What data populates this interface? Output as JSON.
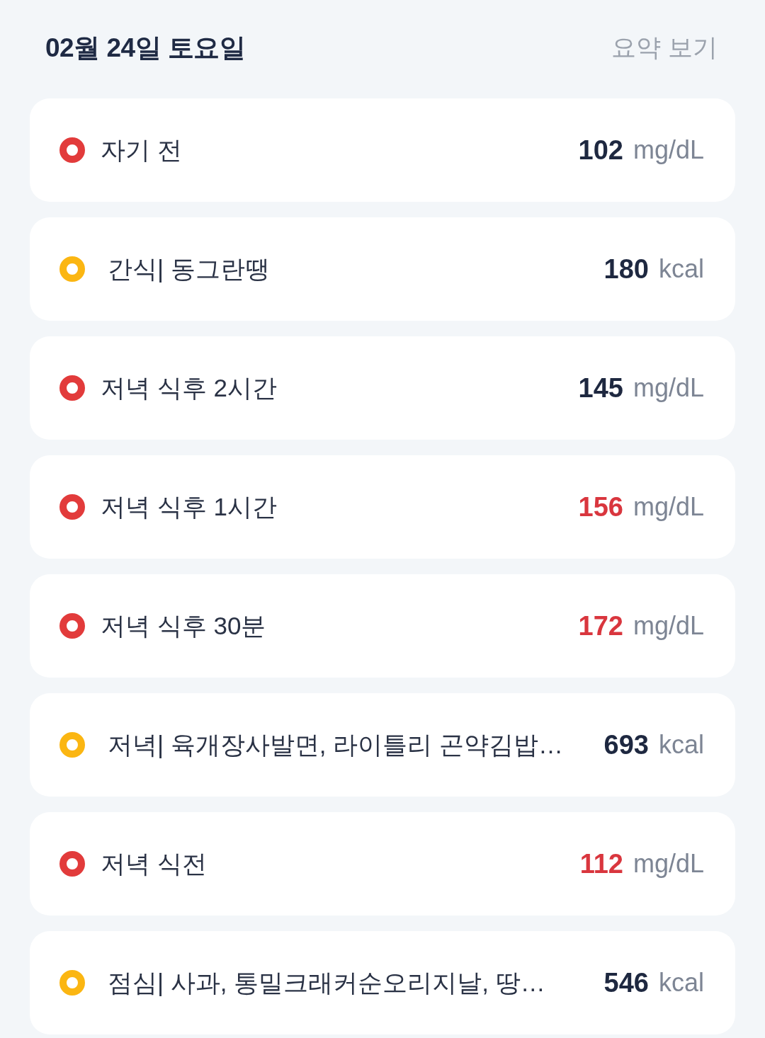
{
  "header": {
    "date": "02월 24일 토요일",
    "summary_link": "요약 보기"
  },
  "entries": [
    {
      "kind": "glucose",
      "label": "자기 전",
      "value": "102",
      "unit": "mg/dL",
      "alert": false
    },
    {
      "kind": "meal",
      "label": "간식| 동그란땡",
      "value": "180",
      "unit": "kcal",
      "alert": false
    },
    {
      "kind": "glucose",
      "label": "저녁 식후 2시간",
      "value": "145",
      "unit": "mg/dL",
      "alert": false
    },
    {
      "kind": "glucose",
      "label": "저녁 식후 1시간",
      "value": "156",
      "unit": "mg/dL",
      "alert": true
    },
    {
      "kind": "glucose",
      "label": "저녁 식후 30분",
      "value": "172",
      "unit": "mg/dL",
      "alert": true
    },
    {
      "kind": "meal",
      "label": "저녁| 육개장사발면, 라이틀리 곤약김밥…",
      "value": "693",
      "unit": "kcal",
      "alert": false
    },
    {
      "kind": "glucose",
      "label": "저녁 식전",
      "value": "112",
      "unit": "mg/dL",
      "alert": true
    },
    {
      "kind": "meal",
      "label": "점심| 사과, 통밀크래커순오리지날, 땅…",
      "value": "546",
      "unit": "kcal",
      "alert": false
    }
  ]
}
